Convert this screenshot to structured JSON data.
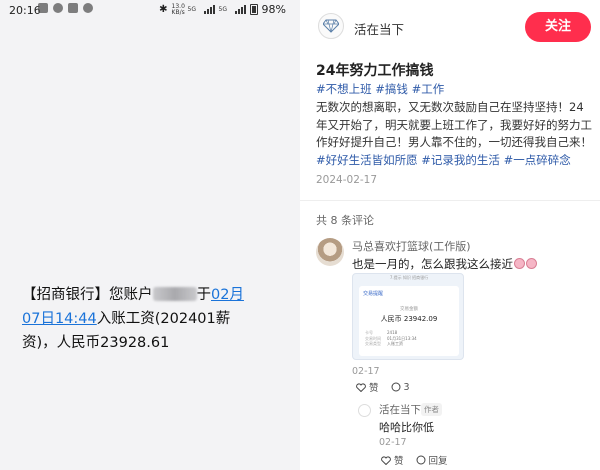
{
  "status_bar": {
    "time": "20:16",
    "net_speed": "13.0",
    "net_unit": "KB/s",
    "net1": "5G",
    "net2": "5G",
    "battery": "98%"
  },
  "sms": {
    "bank": "【招商银行】",
    "text_before_redaction": "您账户",
    "text_after_redaction": "于",
    "date_link": "02月07日14:44",
    "text_after_link": "入账工资(202401薪资)，人民币23928.61"
  },
  "author": {
    "name": "活在当下",
    "avatar_icon": "diamond-icon"
  },
  "follow_button": {
    "label": "关注",
    "color": "#ff2e4d"
  },
  "post": {
    "title": "24年努力工作搞钱",
    "tags_top": [
      "#不想上班",
      "#搞钱",
      "#工作"
    ],
    "body": "无数次的想离职，又无数次鼓励自己在坚持坚持！24年又开始了，明天就要上班工作了，我要好好的努力工作好好提升自己！男人靠不住的，一切还得我自己来！",
    "tags_bottom": [
      "#好好生活皆如所愿",
      "#记录我的生活",
      "#一点碎碎念"
    ],
    "date": "2024-02-17"
  },
  "comments": {
    "count_label": "共 8 条评论",
    "items": [
      {
        "name": "马总喜欢打篮球(工作版)",
        "text": "也是一月的，怎么跟我这么接近",
        "date": "02-17",
        "like_label": "赞",
        "reply_count": "3",
        "image": {
          "header": "7.提示 知识 招商银行",
          "title": "交易提醒",
          "subtitle": "交易金额",
          "amount": "人民币 23942.09",
          "rows": [
            {
              "k": "卡号",
              "v": "2418"
            },
            {
              "k": "交易时间",
              "v": "01月31日13:34"
            },
            {
              "k": "交易类型",
              "v": "入账工资"
            }
          ]
        }
      }
    ],
    "reply": {
      "name": "活在当下",
      "badge": "作者",
      "text": "哈哈比你低",
      "date": "02-17",
      "like_label": "赞",
      "reply_label": "回复"
    }
  }
}
